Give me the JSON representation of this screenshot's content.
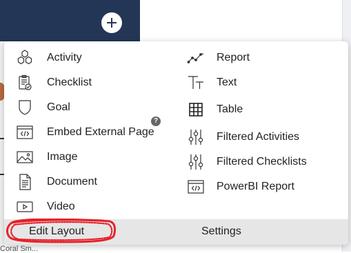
{
  "background": {
    "header_color": "#243656",
    "add_icon": "plus-icon",
    "bottom_text": "Coral Sm..."
  },
  "menu": {
    "left_items": [
      {
        "label": "Activity",
        "icon": "hexagons-icon"
      },
      {
        "label": "Checklist",
        "icon": "clipboard-check-icon"
      },
      {
        "label": "Goal",
        "icon": "shield-icon"
      },
      {
        "label": "Embed External Page",
        "icon": "code-window-icon"
      },
      {
        "label": "Image",
        "icon": "image-icon"
      },
      {
        "label": "Document",
        "icon": "document-icon"
      },
      {
        "label": "Video",
        "icon": "play-icon"
      }
    ],
    "right_items": [
      {
        "label": "Report",
        "icon": "line-chart-icon"
      },
      {
        "label": "Text",
        "icon": "text-icon"
      },
      {
        "label": "Table",
        "icon": "table-grid-icon"
      },
      {
        "label": "Filtered Activities",
        "icon": "sliders-icon"
      },
      {
        "label": "Filtered Checklists",
        "icon": "sliders-icon"
      },
      {
        "label": "PowerBI Report",
        "icon": "code-window-icon"
      }
    ],
    "help_badge": "?",
    "footer": {
      "edit_layout": "Edit Layout",
      "settings": "Settings",
      "highlight_color": "#e8202a"
    }
  }
}
